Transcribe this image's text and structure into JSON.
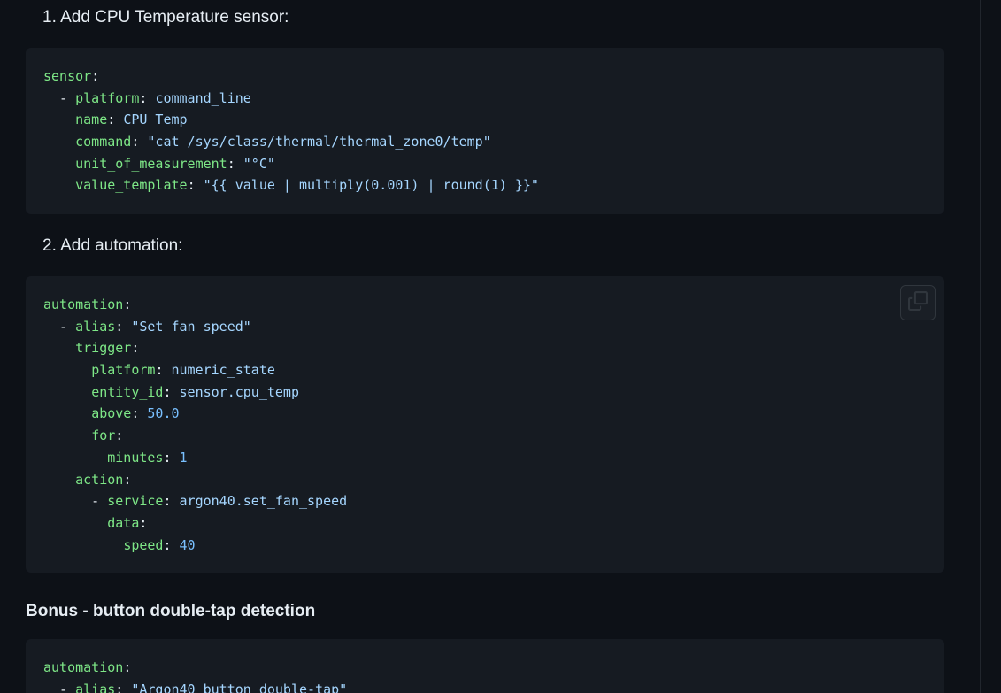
{
  "step1": {
    "title": "1. Add CPU Temperature sensor:",
    "code": [
      [
        {
          "t": "sensor",
          "c": "key"
        },
        {
          "t": ":",
          "c": "punct"
        }
      ],
      [
        {
          "t": "  - ",
          "c": "punct"
        },
        {
          "t": "platform",
          "c": "key"
        },
        {
          "t": ": ",
          "c": "punct"
        },
        {
          "t": "command_line",
          "c": "val"
        }
      ],
      [
        {
          "t": "    ",
          "c": "punct"
        },
        {
          "t": "name",
          "c": "key"
        },
        {
          "t": ": ",
          "c": "punct"
        },
        {
          "t": "CPU Temp",
          "c": "val"
        }
      ],
      [
        {
          "t": "    ",
          "c": "punct"
        },
        {
          "t": "command",
          "c": "key"
        },
        {
          "t": ": ",
          "c": "punct"
        },
        {
          "t": "\"cat /sys/class/thermal/thermal_zone0/temp\"",
          "c": "val"
        }
      ],
      [
        {
          "t": "    ",
          "c": "punct"
        },
        {
          "t": "unit_of_measurement",
          "c": "key"
        },
        {
          "t": ": ",
          "c": "punct"
        },
        {
          "t": "\"°C\"",
          "c": "val"
        }
      ],
      [
        {
          "t": "    ",
          "c": "punct"
        },
        {
          "t": "value_template",
          "c": "key"
        },
        {
          "t": ": ",
          "c": "punct"
        },
        {
          "t": "\"{{ value | multiply(0.001) | round(1) }}\"",
          "c": "val"
        }
      ]
    ]
  },
  "step2": {
    "title": "2. Add automation:",
    "code": [
      [
        {
          "t": "automation",
          "c": "key"
        },
        {
          "t": ":",
          "c": "punct"
        }
      ],
      [
        {
          "t": "  - ",
          "c": "punct"
        },
        {
          "t": "alias",
          "c": "key"
        },
        {
          "t": ": ",
          "c": "punct"
        },
        {
          "t": "\"Set fan speed\"",
          "c": "val"
        }
      ],
      [
        {
          "t": "    ",
          "c": "punct"
        },
        {
          "t": "trigger",
          "c": "key"
        },
        {
          "t": ":",
          "c": "punct"
        }
      ],
      [
        {
          "t": "      ",
          "c": "punct"
        },
        {
          "t": "platform",
          "c": "key"
        },
        {
          "t": ": ",
          "c": "punct"
        },
        {
          "t": "numeric_state",
          "c": "val"
        }
      ],
      [
        {
          "t": "      ",
          "c": "punct"
        },
        {
          "t": "entity_id",
          "c": "key"
        },
        {
          "t": ": ",
          "c": "punct"
        },
        {
          "t": "sensor.cpu_temp",
          "c": "val"
        }
      ],
      [
        {
          "t": "      ",
          "c": "punct"
        },
        {
          "t": "above",
          "c": "key"
        },
        {
          "t": ": ",
          "c": "punct"
        },
        {
          "t": "50.0",
          "c": "num"
        }
      ],
      [
        {
          "t": "      ",
          "c": "punct"
        },
        {
          "t": "for",
          "c": "key"
        },
        {
          "t": ":",
          "c": "punct"
        }
      ],
      [
        {
          "t": "        ",
          "c": "punct"
        },
        {
          "t": "minutes",
          "c": "key"
        },
        {
          "t": ": ",
          "c": "punct"
        },
        {
          "t": "1",
          "c": "num"
        }
      ],
      [
        {
          "t": "    ",
          "c": "punct"
        },
        {
          "t": "action",
          "c": "key"
        },
        {
          "t": ":",
          "c": "punct"
        }
      ],
      [
        {
          "t": "      - ",
          "c": "punct"
        },
        {
          "t": "service",
          "c": "key"
        },
        {
          "t": ": ",
          "c": "punct"
        },
        {
          "t": "argon40.set_fan_speed",
          "c": "val"
        }
      ],
      [
        {
          "t": "        ",
          "c": "punct"
        },
        {
          "t": "data",
          "c": "key"
        },
        {
          "t": ":",
          "c": "punct"
        }
      ],
      [
        {
          "t": "          ",
          "c": "punct"
        },
        {
          "t": "speed",
          "c": "key"
        },
        {
          "t": ": ",
          "c": "punct"
        },
        {
          "t": "40",
          "c": "num"
        }
      ]
    ],
    "copy_icon": "copy-icon"
  },
  "bonus": {
    "heading": "Bonus - button double-tap detection",
    "code": [
      [
        {
          "t": "automation",
          "c": "key"
        },
        {
          "t": ":",
          "c": "punct"
        }
      ],
      [
        {
          "t": "  - ",
          "c": "punct"
        },
        {
          "t": "alias",
          "c": "key"
        },
        {
          "t": ": ",
          "c": "punct"
        },
        {
          "t": "\"Argon40 button double-tap\"",
          "c": "val"
        }
      ]
    ]
  }
}
